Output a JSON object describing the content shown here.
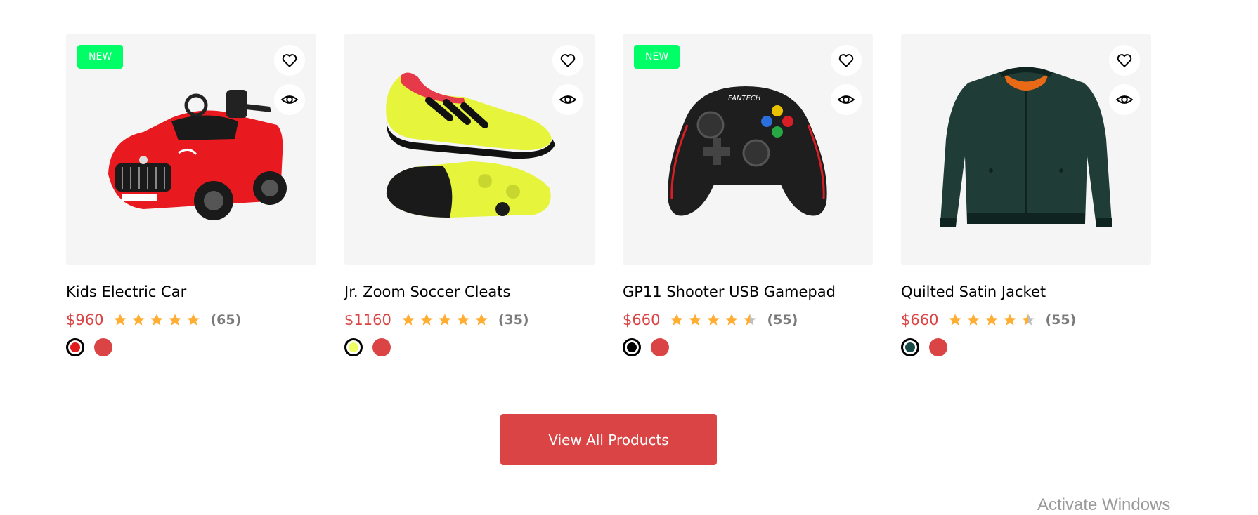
{
  "products": [
    {
      "name": "Kids Electric Car",
      "price": "$960",
      "rating": 5,
      "reviews": "(65)",
      "badge": "NEW",
      "art": "kids-car-icon",
      "colors": [
        "#e31b1b",
        "#db4444"
      ]
    },
    {
      "name": "Jr. Zoom Soccer Cleats",
      "price": "$1160",
      "rating": 5,
      "reviews": "(35)",
      "badge": "",
      "art": "soccer-cleats-icon",
      "colors": [
        "#eeff61",
        "#db4444"
      ]
    },
    {
      "name": "GP11 Shooter USB Gamepad",
      "price": "$660",
      "rating": 4.5,
      "reviews": "(55)",
      "badge": "NEW",
      "art": "gamepad-icon",
      "colors": [
        "#000000",
        "#db4444"
      ]
    },
    {
      "name": "Quilted Satin Jacket",
      "price": "$660",
      "rating": 4.5,
      "reviews": "(55)",
      "badge": "",
      "art": "jacket-icon",
      "colors": [
        "#184a48",
        "#db4444"
      ]
    }
  ],
  "view_all_label": "View All Products",
  "watermark": "Activate Windows",
  "colors": {
    "accent": "#db4444",
    "badge": "#00ff66",
    "star": "#ffad33",
    "star_empty": "#bfbfbf"
  }
}
